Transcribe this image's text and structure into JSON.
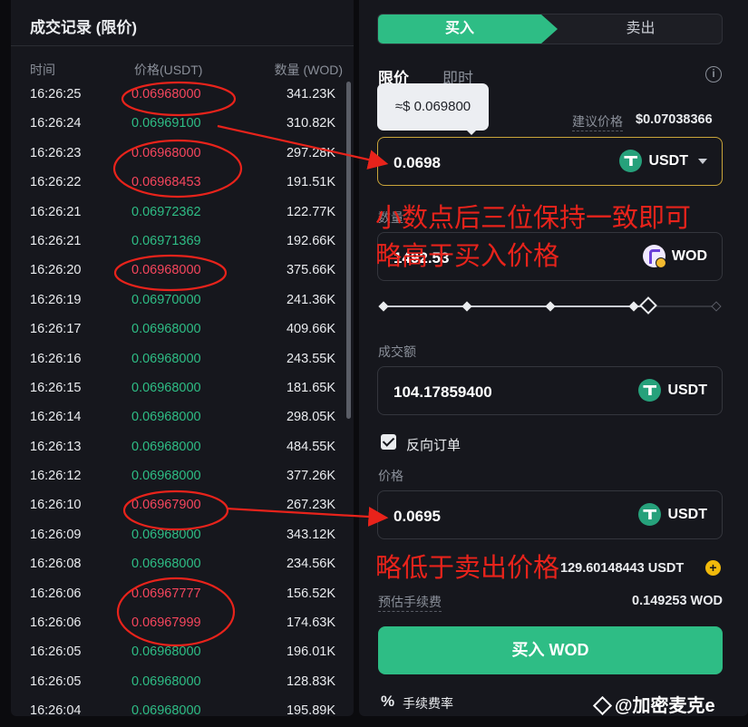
{
  "trade_history": {
    "title": "成交记录 (限价)",
    "columns": {
      "time": "时间",
      "price": "价格(USDT)",
      "qty": "数量 (WOD)"
    },
    "rows": [
      {
        "time": "16:26:25",
        "price": "0.06968000",
        "qty": "341.23K",
        "side": "down"
      },
      {
        "time": "16:26:24",
        "price": "0.06969100",
        "qty": "310.82K",
        "side": "up"
      },
      {
        "time": "16:26:23",
        "price": "0.06968000",
        "qty": "297.28K",
        "side": "down"
      },
      {
        "time": "16:26:22",
        "price": "0.06968453",
        "qty": "191.51K",
        "side": "down"
      },
      {
        "time": "16:26:21",
        "price": "0.06972362",
        "qty": "122.77K",
        "side": "up"
      },
      {
        "time": "16:26:21",
        "price": "0.06971369",
        "qty": "192.66K",
        "side": "up"
      },
      {
        "time": "16:26:20",
        "price": "0.06968000",
        "qty": "375.66K",
        "side": "down"
      },
      {
        "time": "16:26:19",
        "price": "0.06970000",
        "qty": "241.36K",
        "side": "up"
      },
      {
        "time": "16:26:17",
        "price": "0.06968000",
        "qty": "409.66K",
        "side": "up"
      },
      {
        "time": "16:26:16",
        "price": "0.06968000",
        "qty": "243.55K",
        "side": "up"
      },
      {
        "time": "16:26:15",
        "price": "0.06968000",
        "qty": "181.65K",
        "side": "up"
      },
      {
        "time": "16:26:14",
        "price": "0.06968000",
        "qty": "298.05K",
        "side": "up"
      },
      {
        "time": "16:26:13",
        "price": "0.06968000",
        "qty": "484.55K",
        "side": "up"
      },
      {
        "time": "16:26:12",
        "price": "0.06968000",
        "qty": "377.26K",
        "side": "up"
      },
      {
        "time": "16:26:10",
        "price": "0.06967900",
        "qty": "267.23K",
        "side": "down"
      },
      {
        "time": "16:26:09",
        "price": "0.06968000",
        "qty": "343.12K",
        "side": "up"
      },
      {
        "time": "16:26:08",
        "price": "0.06968000",
        "qty": "234.56K",
        "side": "up"
      },
      {
        "time": "16:26:06",
        "price": "0.06967777",
        "qty": "156.52K",
        "side": "down"
      },
      {
        "time": "16:26:06",
        "price": "0.06967999",
        "qty": "174.63K",
        "side": "down"
      },
      {
        "time": "16:26:05",
        "price": "0.06968000",
        "qty": "196.01K",
        "side": "up"
      },
      {
        "time": "16:26:05",
        "price": "0.06968000",
        "qty": "128.83K",
        "side": "up"
      },
      {
        "time": "16:26:04",
        "price": "0.06968000",
        "qty": "195.89K",
        "side": "up"
      }
    ],
    "colors": {
      "up": "#2ebd85",
      "down": "#f6465d"
    }
  },
  "order_form": {
    "tab_buy": "买入",
    "tab_sell": "卖出",
    "type_limit": "限价",
    "type_market": "即时",
    "info_icon": "info-icon",
    "tooltip": "≈$ 0.069800",
    "suggest_label": "建议价格",
    "suggest_value": "$0.07038366",
    "price_value": "0.0698",
    "price_coin": "USDT",
    "amount_label": "数量",
    "amount_value": "1492.53",
    "amount_coin": "WOD",
    "total_label": "成交额",
    "total_value": "104.17859400",
    "total_coin": "USDT",
    "reverse_order_label": "反向订单",
    "reverse_order_checked": true,
    "reverse_price_label": "价格",
    "reverse_price_value": "0.0695",
    "reverse_price_coin": "USDT",
    "available_value": "129.60148443 USDT",
    "fee_label": "预估手续费",
    "fee_value": "0.149253 WOD",
    "buy_button": "买入 WOD",
    "fee_rate_icon": "percent-icon",
    "fee_rate_label": "手续费率",
    "accent": "#2ebd85"
  },
  "annotations": {
    "note_1": "小数点后三位保持一致即可",
    "note_2": "略高于买入价格",
    "note_3": "略低于卖出价格",
    "color": "#e8231b"
  },
  "watermark": {
    "text": "@加密麦克e"
  }
}
